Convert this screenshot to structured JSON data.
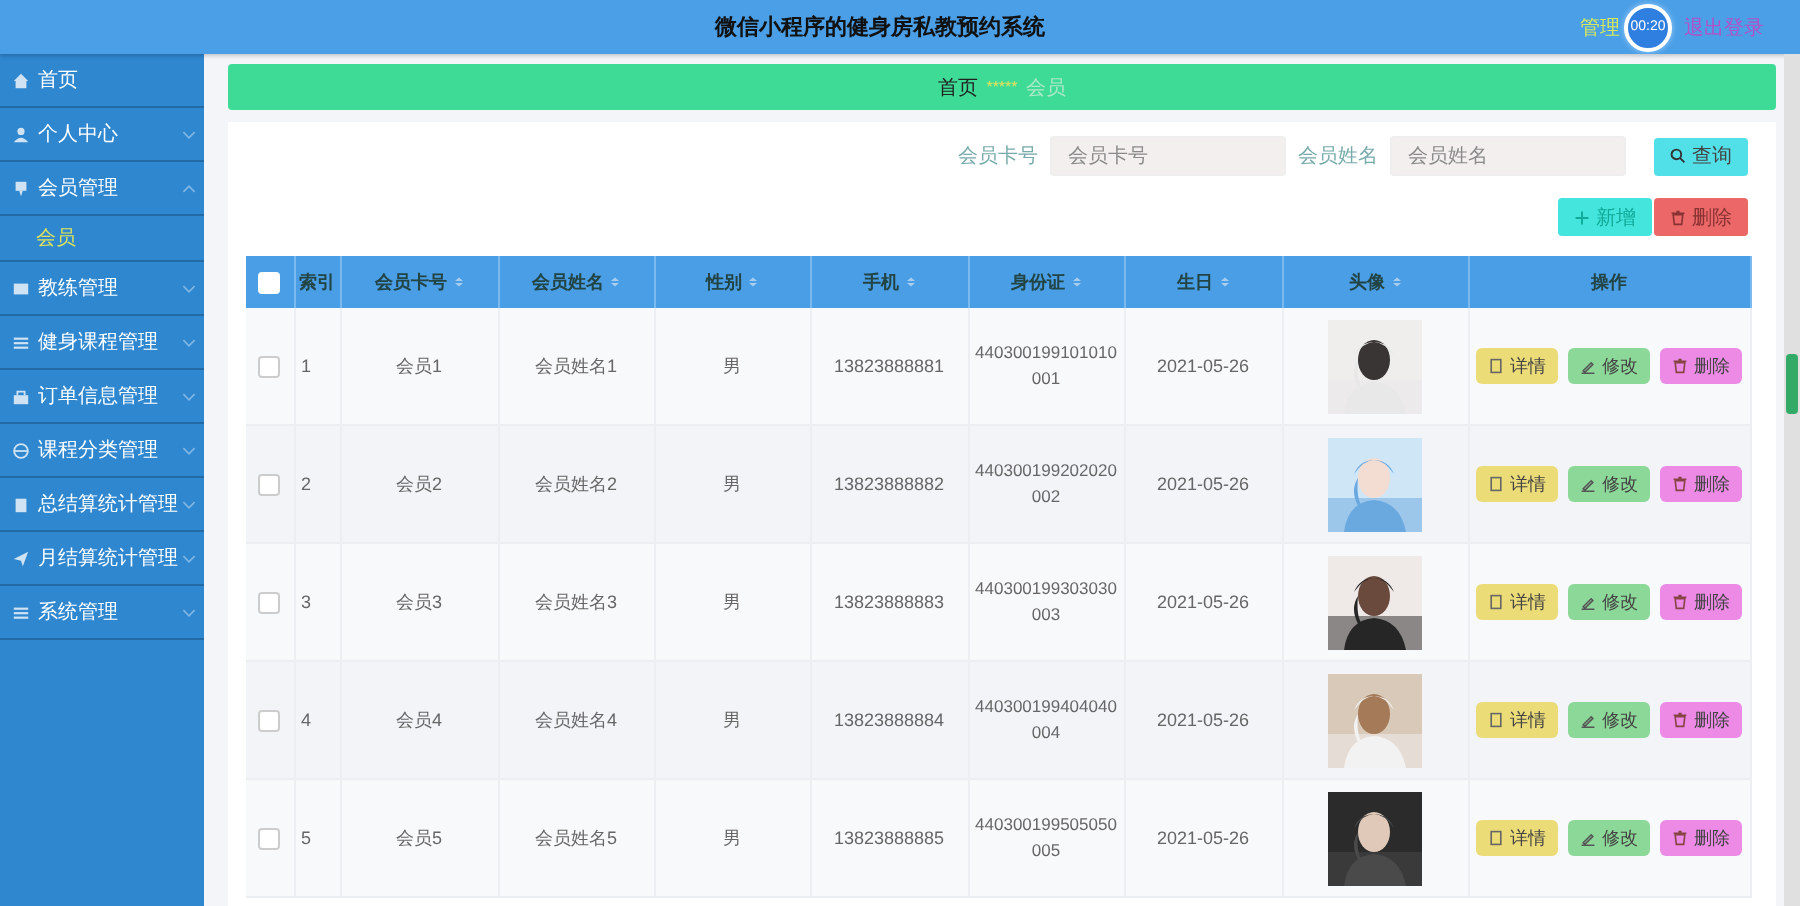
{
  "header": {
    "title": "微信小程序的健身房私教预约系统",
    "user": "管理",
    "timer": "00:20",
    "logout": "退出登录"
  },
  "sidebar": {
    "items": [
      {
        "label": "首页",
        "kind": "link"
      },
      {
        "label": "个人中心",
        "kind": "menu",
        "expanded": false
      },
      {
        "label": "会员管理",
        "kind": "menu",
        "expanded": true,
        "children": [
          {
            "label": "会员",
            "selected": true
          }
        ]
      },
      {
        "label": "教练管理",
        "kind": "menu",
        "expanded": false
      },
      {
        "label": "健身课程管理",
        "kind": "menu",
        "expanded": false
      },
      {
        "label": "订单信息管理",
        "kind": "menu",
        "expanded": false
      },
      {
        "label": "课程分类管理",
        "kind": "menu",
        "expanded": false
      },
      {
        "label": "总结算统计管理",
        "kind": "menu",
        "expanded": false
      },
      {
        "label": "月结算统计管理",
        "kind": "menu",
        "expanded": false
      },
      {
        "label": "系统管理",
        "kind": "menu",
        "expanded": false
      }
    ]
  },
  "breadcrumb": {
    "items": [
      "首页",
      "会员"
    ],
    "separator": "*****"
  },
  "search": {
    "fields": [
      {
        "label": "会员卡号",
        "placeholder": "会员卡号"
      },
      {
        "label": "会员姓名",
        "placeholder": "会员姓名"
      }
    ],
    "button": "查询"
  },
  "actions": [
    {
      "label": "新增",
      "kind": "add"
    },
    {
      "label": "删除",
      "kind": "delete"
    }
  ],
  "table": {
    "select_all": false,
    "columns": [
      {
        "label": "索引",
        "sortable": false
      },
      {
        "label": "会员卡号",
        "sortable": true
      },
      {
        "label": "会员姓名",
        "sortable": true
      },
      {
        "label": "性别",
        "sortable": true
      },
      {
        "label": "手机",
        "sortable": true
      },
      {
        "label": "身份证",
        "sortable": true
      },
      {
        "label": "生日",
        "sortable": true
      },
      {
        "label": "头像",
        "sortable": true
      },
      {
        "label": "操作",
        "sortable": false
      }
    ],
    "rows": [
      {
        "checked": false,
        "cells": [
          "1",
          "会员1",
          "会员姓名1",
          "男",
          "13823888881",
          "440300199101010001",
          "2021-05-26"
        ],
        "buttons": [
          {
            "label": "详情",
            "kind": "detail"
          },
          {
            "label": "修改",
            "kind": "edit"
          },
          {
            "label": "删除",
            "kind": "delete"
          }
        ]
      },
      {
        "checked": false,
        "cells": [
          "2",
          "会员2",
          "会员姓名2",
          "男",
          "13823888882",
          "440300199202020002",
          "2021-05-26"
        ],
        "buttons": [
          {
            "label": "详情",
            "kind": "detail"
          },
          {
            "label": "修改",
            "kind": "edit"
          },
          {
            "label": "删除",
            "kind": "delete"
          }
        ]
      },
      {
        "checked": false,
        "cells": [
          "3",
          "会员3",
          "会员姓名3",
          "男",
          "13823888883",
          "440300199303030003",
          "2021-05-26"
        ],
        "buttons": [
          {
            "label": "详情",
            "kind": "detail"
          },
          {
            "label": "修改",
            "kind": "edit"
          },
          {
            "label": "删除",
            "kind": "delete"
          }
        ]
      },
      {
        "checked": false,
        "cells": [
          "4",
          "会员4",
          "会员姓名4",
          "男",
          "13823888884",
          "440300199404040004",
          "2021-05-26"
        ],
        "buttons": [
          {
            "label": "详情",
            "kind": "detail"
          },
          {
            "label": "修改",
            "kind": "edit"
          },
          {
            "label": "删除",
            "kind": "delete"
          }
        ]
      },
      {
        "checked": false,
        "cells": [
          "5",
          "会员5",
          "会员姓名5",
          "男",
          "13823888885",
          "440300199505050005",
          "2021-05-26"
        ],
        "buttons": [
          {
            "label": "详情",
            "kind": "detail"
          },
          {
            "label": "修改",
            "kind": "edit"
          },
          {
            "label": "删除",
            "kind": "delete"
          }
        ]
      }
    ]
  }
}
